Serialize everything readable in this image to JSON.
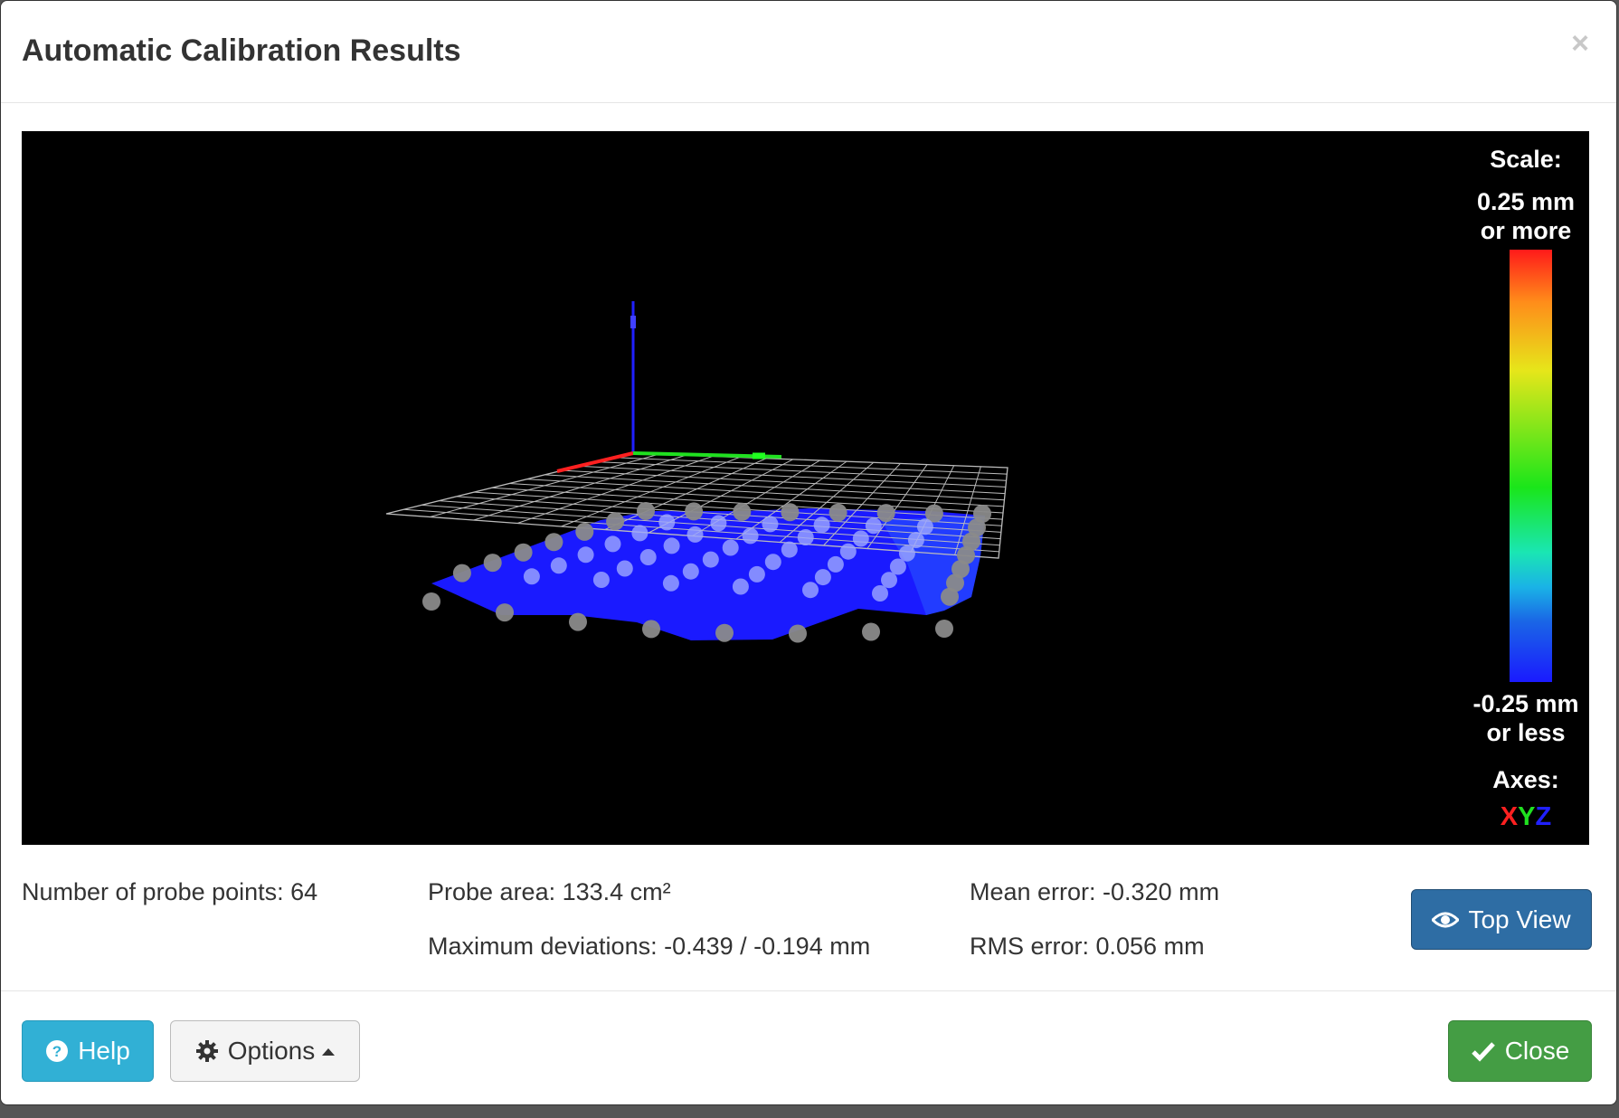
{
  "dialog": {
    "title": "Automatic Calibration Results",
    "close_glyph": "×"
  },
  "legend": {
    "scale_title": "Scale:",
    "top_line1": "0.25 mm",
    "top_line2": "or more",
    "bottom_line1": "-0.25 mm",
    "bottom_line2": "or less",
    "axes_title": "Axes:",
    "axis_x": "X",
    "axis_y": "Y",
    "axis_z": "Z",
    "colors": {
      "x": "#ff2020",
      "y": "#20e020",
      "z": "#2020ff",
      "surface": "#1a1aff",
      "grid": "#bbbbbb",
      "probe": "#9a9a9a"
    }
  },
  "stats": {
    "probe_points": "Number of probe points: 64",
    "probe_area": "Probe area: 133.4 cm²",
    "max_deviations": "Maximum deviations: -0.439 / -0.194 mm",
    "mean_error": "Mean error: -0.320 mm",
    "rms_error": "RMS error: 0.056 mm"
  },
  "buttons": {
    "top_view": "Top View",
    "top_view_icon": "eye-icon",
    "help": "Help",
    "help_icon": "question-circle-icon",
    "options": "Options",
    "options_icon": "gear-icon",
    "options_caret": "caret-up-icon",
    "close": "Close",
    "close_icon": "checkmark-icon"
  }
}
